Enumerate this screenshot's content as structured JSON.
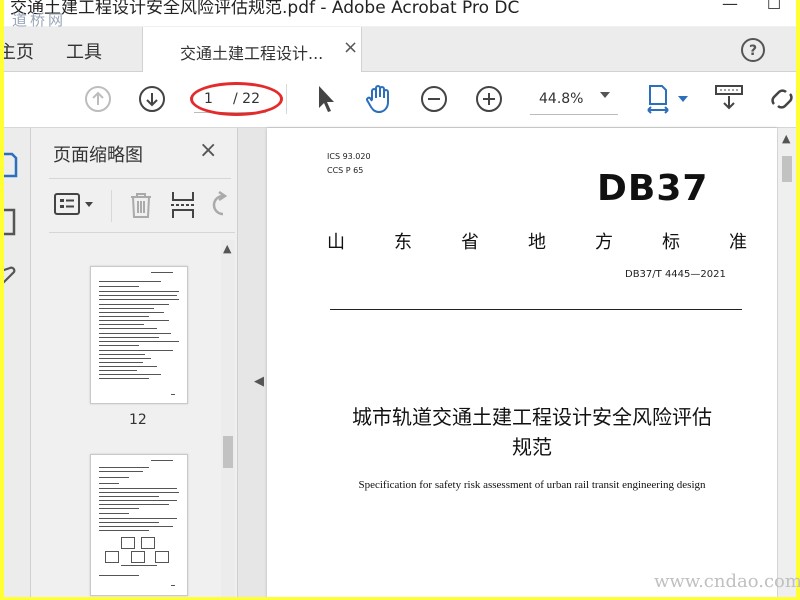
{
  "window": {
    "title": "交通土建工程设计安全风险评估规范.pdf - Adobe Acrobat Pro DC",
    "watermark_top": "道桥网"
  },
  "tabs": {
    "home": "主页",
    "tools": "工具",
    "document": "交通土建工程设计...",
    "close_symbol": "×"
  },
  "toolbar": {
    "page_current": "1",
    "page_total": "/ 22",
    "zoom": "44.8%"
  },
  "thumbnail_panel": {
    "title": "页面缩略图",
    "close_symbol": "×",
    "thumbnails": [
      {
        "page_label": "12"
      }
    ]
  },
  "document_page": {
    "ics": "ICS  93.020",
    "ccs": "CCS  P  65",
    "db_code": "DB37",
    "standard_type_chars": [
      "山",
      "东",
      "省",
      "地",
      "方",
      "标",
      "准"
    ],
    "standard_number": "DB37/T  4445—2021",
    "title_cn_line1": "城市轨道交通土建工程设计安全风险评估",
    "title_cn_line2": "规范",
    "title_en": "Specification for safety risk assessment of urban rail transit engineering design"
  },
  "watermark_bottom": "www.cndao.com",
  "colors": {
    "frame": "#ffff33",
    "annotation_circle": "#e42b2b",
    "accent_blue": "#2c6fbd"
  },
  "icons": [
    "help-icon",
    "prev-page-icon",
    "next-page-icon",
    "select-cursor-icon",
    "hand-tool-icon",
    "zoom-out-icon",
    "zoom-in-icon",
    "fit-page-icon",
    "scroll-mode-icon",
    "link-icon",
    "page-thumbnails-icon",
    "bookmark-icon",
    "attachment-icon",
    "thumbnail-options-icon",
    "delete-icon",
    "insert-page-icon",
    "rotate-icon"
  ]
}
